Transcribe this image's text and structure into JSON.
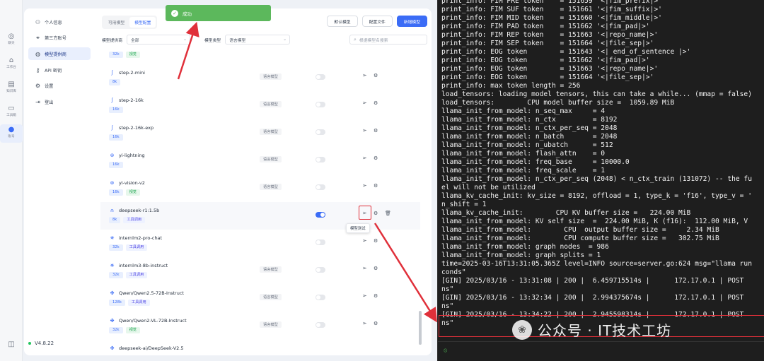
{
  "rail": {
    "items": [
      {
        "icon": "chat-icon",
        "label": "聊天"
      },
      {
        "icon": "workbench-icon",
        "label": "工作台"
      },
      {
        "icon": "knowledge-icon",
        "label": "知识库"
      },
      {
        "icon": "toolbox-icon",
        "label": "工具箱"
      },
      {
        "icon": "account-icon",
        "label": "账号"
      }
    ],
    "bottom_icon": "feedback-icon"
  },
  "menu": {
    "items": [
      {
        "label": "个人信息",
        "icon": "user-icon"
      },
      {
        "label": "第三方账号",
        "icon": "link-icon"
      },
      {
        "label": "模型提供商",
        "icon": "globe-icon"
      },
      {
        "label": "API 密钥",
        "icon": "key-icon"
      },
      {
        "label": "设置",
        "icon": "gear-icon"
      },
      {
        "label": "登出",
        "icon": "logout-icon"
      }
    ],
    "version": "V4.8.22"
  },
  "tabs": [
    "可用模型",
    "模型配置"
  ],
  "buttons": {
    "default_model": "默认模型",
    "config_file": "配置文件",
    "add_model": "新增模型"
  },
  "filters": {
    "provider_label": "模型提供商",
    "provider_value": "全部",
    "type_label": "模型类型",
    "type_value": "语言模型",
    "search_placeholder": "根据模型名搜索"
  },
  "toast": "成功",
  "tooltip": "模型测试",
  "models": [
    {
      "name": "",
      "tags": [
        "32k",
        "视觉"
      ],
      "type": "",
      "enabled": false
    },
    {
      "name": "step-2-mini",
      "tags": [
        "8k"
      ],
      "type": "语言模型",
      "enabled": false
    },
    {
      "name": "step-2-16k",
      "tags": [
        "16k"
      ],
      "type": "语言模型",
      "enabled": false
    },
    {
      "name": "step-2-16k-exp",
      "tags": [
        "16k"
      ],
      "type": "语言模型",
      "enabled": false
    },
    {
      "name": "yi-lightning",
      "tags": [
        "16k"
      ],
      "type": "语言模型",
      "enabled": false
    },
    {
      "name": "yi-vision-v2",
      "tags": [
        "16k",
        "视觉"
      ],
      "type": "语言模型",
      "enabled": false
    },
    {
      "name": "deepseek-r1:1.5b",
      "tags": [
        "8k",
        "工具调用"
      ],
      "type": "",
      "enabled": true
    },
    {
      "name": "internlm2-pro-chat",
      "tags": [
        "32k",
        "工具调用"
      ],
      "type": "",
      "enabled": false
    },
    {
      "name": "internlm3-8b-instruct",
      "tags": [
        "32k",
        "工具调用"
      ],
      "type": "语言模型",
      "enabled": false
    },
    {
      "name": "Qwen/Qwen2.5-72B-Instruct",
      "tags": [
        "128k",
        "工具调用"
      ],
      "type": "语言模型",
      "enabled": false
    },
    {
      "name": "Qwen/Qwen2-VL-72B-Instruct",
      "tags": [
        "32k",
        "视觉"
      ],
      "type": "语言模型",
      "enabled": false
    },
    {
      "name": "deepseek-ai/DeepSeek-V2.5",
      "tags": [],
      "type": "",
      "enabled": false
    }
  ],
  "terminal": {
    "lines": [
      "print_info: FIM PRE token    = 151659 '<|fim_prefix|>'",
      "print_info: FIM SUF token    = 151661 '<|fim_suffix|>'",
      "print_info: FIM MID token    = 151660 '<|fim_middle|>'",
      "print_info: FIM PAD token    = 151662 '<|fim_pad|>'",
      "print_info: FIM REP token    = 151663 '<|repo_name|>'",
      "print_info: FIM SEP token    = 151664 '<|file_sep|>'",
      "print_info: EOG token        = 151643 '<| end_of_sentence |>'",
      "print_info: EOG token        = 151662 '<|fim_pad|>'",
      "print_info: EOG token        = 151663 '<|repo_name|>'",
      "print_info: EOG token        = 151664 '<|file_sep|>'",
      "print_info: max token length = 256",
      "load_tensors: loading model tensors, this can take a while... (mmap = false)",
      "load_tensors:        CPU model buffer size =  1059.89 MiB",
      "llama_init_from_model: n_seq_max     = 4",
      "llama_init_from_model: n_ctx         = 8192",
      "llama_init_from_model: n_ctx_per_seq = 2048",
      "llama_init_from_model: n_batch       = 2048",
      "llama_init_from_model: n_ubatch      = 512",
      "llama_init_from_model: flash_attn    = 0",
      "llama_init_from_model: freq_base     = 10000.0",
      "llama_init_from_model: freq_scale    = 1",
      "llama_init_from_model: n_ctx_per_seq (2048) < n_ctx_train (131072) -- the fu",
      "el will not be utilized",
      "llama_kv_cache_init: kv_size = 8192, offload = 1, type_k = 'f16', type_v = '",
      "n_shift = 1",
      "llama_kv_cache_init:        CPU KV buffer size =   224.00 MiB",
      "llama_init_from_model: KV self size  =  224.00 MiB, K (f16):  112.00 MiB, V",
      "llama_init_from_model:        CPU  output buffer size =     2.34 MiB",
      "llama_init_from_model:        CPU compute buffer size =   302.75 MiB",
      "llama_init_from_model: graph nodes  = 986",
      "llama_init_from_model: graph splits = 1",
      "time=2025-03-16T13:31:05.365Z level=INFO source=server.go:624 msg=\"llama run",
      "conds\"",
      "[GIN] 2025/03/16 - 13:31:08 | 200 |  6.459715514s |      172.17.0.1 | POST",
      "ns\"",
      "[GIN] 2025/03/16 - 13:32:34 | 200 |  2.994375674s |      172.17.0.1 | POST",
      "ns\"",
      "[GIN] 2025/03/16 - 13:34:22 | 200 |  2.945598314s |      172.17.0.1 | POST",
      "ns\""
    ]
  },
  "watermark": "公众号 · IT技术工坊",
  "colors": {
    "accent": "#3b6cf6",
    "toast": "#5cb85c",
    "highlight": "#e0303a",
    "terminal_bg": "#1e1e1e"
  }
}
